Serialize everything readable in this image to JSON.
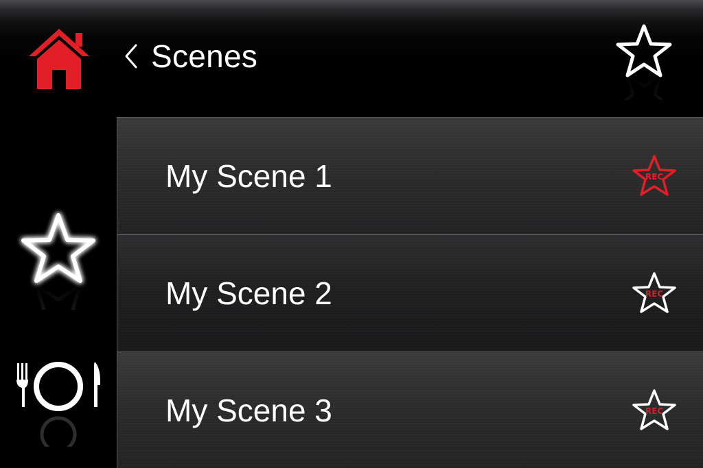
{
  "header": {
    "back_icon": "chevron-left-icon",
    "title": "Scenes",
    "home_icon": "home-icon",
    "favorite_icon": "star-outline-icon"
  },
  "sidebar": {
    "items": [
      {
        "icon": "star-glow-icon",
        "active": true
      },
      {
        "icon": "dining-icon",
        "active": false
      }
    ]
  },
  "scenes": [
    {
      "label": "My Scene 1",
      "rec_label": "REC",
      "recording": true
    },
    {
      "label": "My Scene 2",
      "rec_label": "REC",
      "recording": false
    },
    {
      "label": "My Scene 3",
      "rec_label": "REC",
      "recording": false
    }
  ],
  "colors": {
    "accent_red": "#e21f26",
    "rec_text_red": "#c8242b",
    "text": "#ffffff",
    "background": "#000000"
  }
}
